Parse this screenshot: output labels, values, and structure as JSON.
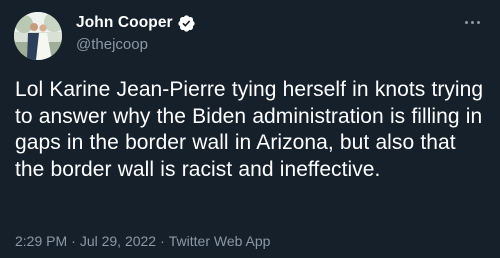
{
  "tweet": {
    "author": {
      "display_name": "John Cooper",
      "handle": "@thejcoop",
      "verified": true,
      "verified_icon": "verified-badge-icon",
      "verified_color": "#ffffff"
    },
    "more_icon": "more-options-icon",
    "text": "Lol Karine Jean-Pierre tying herself in knots trying to answer why the Biden administration is filling in gaps in the border wall in Arizona, but also that the border wall is racist and ineffective.",
    "time": "2:29 PM",
    "date": "Jul 29, 2022",
    "source": "Twitter Web App",
    "separator": "·"
  },
  "colors": {
    "background": "#15202b",
    "text_primary": "#ffffff",
    "text_secondary": "#8b98a5"
  }
}
